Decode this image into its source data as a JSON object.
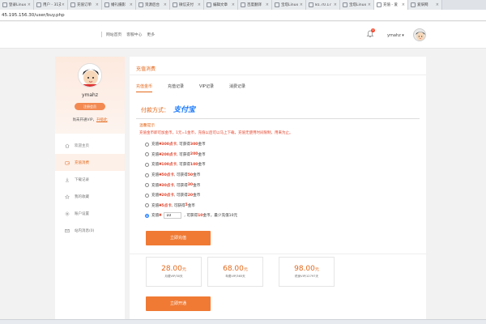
{
  "browser": {
    "tabs": [
      {
        "label": "登录Linux",
        "active": false
      },
      {
        "label": "用户 - 31支",
        "active": false
      },
      {
        "label": "充值订单",
        "active": false
      },
      {
        "label": "婚礼摄影",
        "active": false
      },
      {
        "label": "资源后台",
        "active": false
      },
      {
        "label": "微信支付",
        "active": false
      },
      {
        "label": "编辑文章",
        "active": false
      },
      {
        "label": "百度翻译",
        "active": false
      },
      {
        "label": "宝塔Linux",
        "active": false
      },
      {
        "label": "81.70.17",
        "active": false
      },
      {
        "label": "宝塔Linux",
        "active": false
      },
      {
        "label": "充值 - 爱",
        "active": true
      },
      {
        "label": "爱柒网",
        "active": false
      }
    ],
    "address": "45.195.156.30/user/buy.php"
  },
  "header": {
    "nav": [
      "网站首页",
      "客服中心",
      "更多"
    ],
    "notification_count": "0",
    "username": "ymahz",
    "dropdown_glyph": "▾"
  },
  "sidebar": {
    "username": "ymahz",
    "badge": "注册会员",
    "vip_text": "尚未开通VIP，",
    "vip_link": "升级此",
    "menu": [
      {
        "label": "欢迎主页",
        "icon": "home-icon",
        "active": false
      },
      {
        "label": "充值消费",
        "icon": "wallet-icon",
        "active": true
      },
      {
        "label": "下载记录",
        "icon": "download-icon",
        "active": false
      },
      {
        "label": "我的收藏",
        "icon": "star-icon",
        "active": false
      },
      {
        "label": "账户设置",
        "icon": "gear-icon",
        "active": false
      },
      {
        "label": "站内消息(0)",
        "icon": "message-icon",
        "active": false
      }
    ]
  },
  "main": {
    "title": "充值消费",
    "tabs": [
      {
        "label": "充值金币",
        "active": true
      },
      {
        "label": "充值记录",
        "active": false
      },
      {
        "label": "VIP记录",
        "active": false
      },
      {
        "label": "消费记录",
        "active": false
      }
    ],
    "pay_label": "付款方式：",
    "alipay_logo": "支付宝",
    "tip_title": "温馨提示",
    "tip_body": "充值金币即可加金币，1元=1金币，充值以后可以马上下载，充值无使用时间限制，用来为止。",
    "options": [
      {
        "pre": "充值 ",
        "price": "¥300点卡",
        "mid": ", 可获得 ",
        "coins": "300",
        "post": " 金币"
      },
      {
        "pre": "充值 ",
        "price": "¥200点卡",
        "mid": ", 可获得 ",
        "coins": "200",
        "post": " 金币"
      },
      {
        "pre": "充值 ",
        "price": "¥100点卡",
        "mid": ", 可获得 ",
        "coins": "100",
        "post": " 金币"
      },
      {
        "pre": "充值 ",
        "price": "¥50点卡",
        "mid": ", 可获得 ",
        "coins": "50",
        "post": " 金币"
      },
      {
        "pre": "充值 ",
        "price": "¥30点卡",
        "mid": ", 可获得 ",
        "coins": "30",
        "post": " 金币"
      },
      {
        "pre": "充值 ",
        "price": "¥20点卡",
        "mid": ", 可获得 ",
        "coins": "20",
        "post": " 金币"
      },
      {
        "pre": "充值 ",
        "price": "¥5点卡",
        "mid": ", 可获得 ",
        "coins": "5",
        "post": " 金币"
      }
    ],
    "custom": {
      "pre": "充值 ",
      "currency": "¥",
      "value": "10",
      "mid": ", 可获得 ",
      "coins": "10",
      "post": " 金币，最少充值10元"
    },
    "recharge_button": "立即充值",
    "vip_plans": [
      {
        "price": "28.00",
        "unit": "元",
        "desc": "月费VIP/30天"
      },
      {
        "price": "68.00",
        "unit": "元",
        "desc": "年费VIP/365天"
      },
      {
        "price": "98.00",
        "unit": "元",
        "desc": "终身VIP/12797天"
      }
    ],
    "open_button": "立即开通"
  }
}
